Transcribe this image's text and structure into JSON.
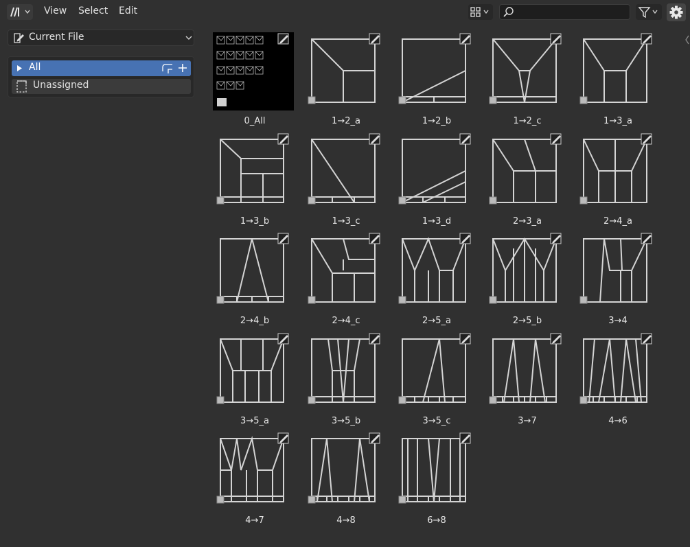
{
  "menus": [
    "View",
    "Select",
    "Edit"
  ],
  "search": {
    "value": "",
    "placeholder": ""
  },
  "library": {
    "selected": "Current File"
  },
  "categories": {
    "all": "All",
    "unassigned": "Unassigned"
  },
  "assets": [
    "0_All",
    "1→2_a",
    "1→2_b",
    "1→2_c",
    "1→3_a",
    "1→3_b",
    "1→3_c",
    "1→3_d",
    "2→3_a",
    "2→4_a",
    "2→4_b",
    "2→4_c",
    "2→5_a",
    "2→5_b",
    "3→4",
    "3→5_a",
    "3→5_b",
    "3→5_c",
    "3→7",
    "4→6",
    "4→7",
    "4→8",
    "6→8"
  ],
  "colors": {
    "header": "#303030",
    "panel": "#282828",
    "accent": "#4772b3",
    "thumb_line": "#d4d4d4"
  },
  "icons": {
    "editor_type": "asset-browser-icon",
    "view": "grid-view-icon",
    "search": "search-icon",
    "filter": "filter-icon",
    "settings": "gear-icon",
    "library": "edit-file-icon",
    "unassigned": "dashed-box-icon",
    "expand": "triangle-right-icon",
    "new_cat": "new-catalog-icon",
    "add": "plus-icon"
  }
}
